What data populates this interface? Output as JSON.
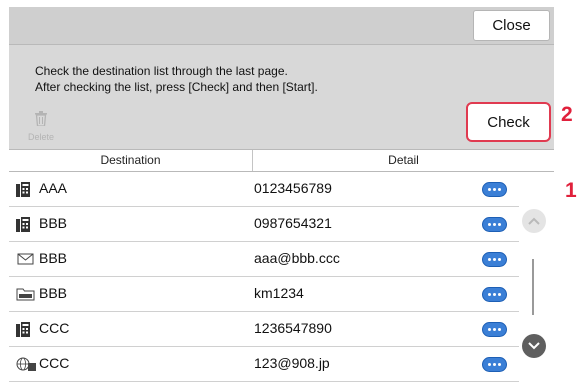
{
  "topbar": {
    "close_label": "Close"
  },
  "message": {
    "line1": "Check the destination list through the last page.",
    "line2": "After checking the list, press [Check] and then [Start]."
  },
  "toolbar": {
    "delete_label": "Delete",
    "check_label": "Check"
  },
  "table": {
    "columns": [
      "Destination",
      "Detail"
    ],
    "rows": [
      {
        "icon": "fax-icon",
        "name": "AAA",
        "detail": "0123456789"
      },
      {
        "icon": "fax-icon",
        "name": "BBB",
        "detail": "0987654321"
      },
      {
        "icon": "email-icon",
        "name": "BBB",
        "detail": "aaa@bbb.ccc"
      },
      {
        "icon": "smb-folder-icon",
        "name": "BBB",
        "detail": "km1234"
      },
      {
        "icon": "fax-icon",
        "name": "CCC",
        "detail": "1236547890"
      },
      {
        "icon": "internet-fax-icon",
        "name": "CCC",
        "detail": "123@908.jp"
      }
    ]
  },
  "callouts": {
    "check": "2",
    "list": "1"
  },
  "colors": {
    "highlight": "#e03a50",
    "accent_blue": "#3b7fd6",
    "callout": "#e0203b"
  }
}
